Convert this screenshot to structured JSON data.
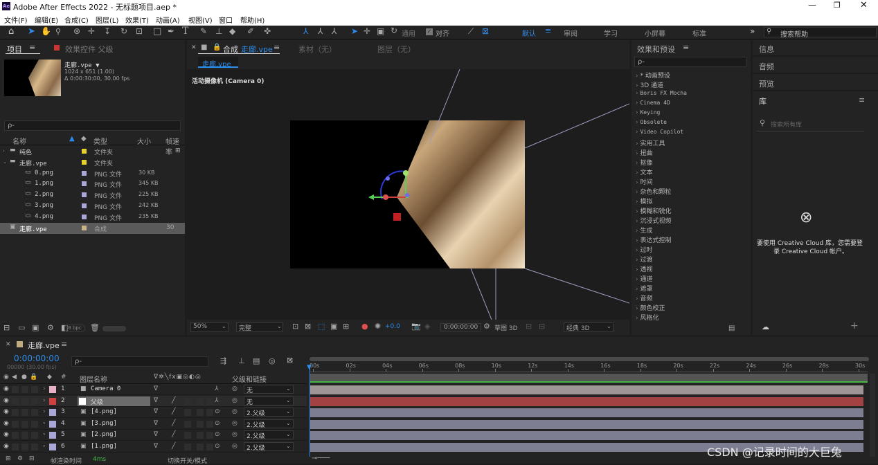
{
  "app": {
    "title": "Adobe After Effects 2022 - 无标题项目.aep *",
    "logo": "Ae"
  },
  "menu": [
    "文件(F)",
    "编辑(E)",
    "合成(C)",
    "图层(L)",
    "效果(T)",
    "动画(A)",
    "视图(V)",
    "窗口",
    "帮助(H)"
  ],
  "toolbar": {
    "snap_label": "对齐",
    "workspaces": [
      "默认",
      "审阅",
      "学习",
      "小屏幕",
      "标准"
    ],
    "search_placeholder": "搜索帮助"
  },
  "project": {
    "tab": "项目",
    "tab2": "效果控件 父级",
    "item_name": "走廊.vpe ▼",
    "item_info1": "1024 x 651 (1.00)",
    "item_info2": "Δ 0:00:30:00, 30.00 fps",
    "search_placeholder": "ρ-",
    "columns": [
      "名称",
      "类型",
      "大小",
      "帧速率"
    ],
    "rows": [
      {
        "name": "纯色",
        "type": "文件夹",
        "size": "",
        "fps": "",
        "indent": 0,
        "kind": "folder",
        "swatch": "#e6d32a"
      },
      {
        "name": "走廊.vpe",
        "type": "文件夹",
        "size": "",
        "fps": "",
        "indent": 0,
        "kind": "folder",
        "swatch": "#e6d32a"
      },
      {
        "name": "0.png",
        "type": "PNG 文件",
        "size": "30 KB",
        "fps": "",
        "indent": 1,
        "kind": "file",
        "swatch": "#a9a7d8"
      },
      {
        "name": "1.png",
        "type": "PNG 文件",
        "size": "345 KB",
        "fps": "",
        "indent": 1,
        "kind": "file",
        "swatch": "#a9a7d8"
      },
      {
        "name": "2.png",
        "type": "PNG 文件",
        "size": "225 KB",
        "fps": "",
        "indent": 1,
        "kind": "file",
        "swatch": "#a9a7d8"
      },
      {
        "name": "3.png",
        "type": "PNG 文件",
        "size": "242 KB",
        "fps": "",
        "indent": 1,
        "kind": "file",
        "swatch": "#a9a7d8"
      },
      {
        "name": "4.png",
        "type": "PNG 文件",
        "size": "235 KB",
        "fps": "",
        "indent": 1,
        "kind": "file",
        "swatch": "#a9a7d8"
      },
      {
        "name": "走廊.vpe",
        "type": "合成",
        "size": "",
        "fps": "30",
        "indent": 0,
        "kind": "comp",
        "swatch": "#c9b48a"
      }
    ],
    "bpc": "8 bpc"
  },
  "comp": {
    "tab_prefix": "合成",
    "tab_name": "走廊.vpe",
    "tab_footage": "素材（无）",
    "tab_layer": "图层（无）",
    "subtab": "走廊.vpe",
    "camera_label": "活动摄像机 (Camera 0)",
    "zoom": "50%",
    "quality": "完整",
    "exposure": "+0.0",
    "timecode": "0:00:00:00",
    "draft": "草图 3D",
    "renderer": "经典 3D"
  },
  "effects": {
    "title": "效果和预设",
    "search_placeholder": "ρ-",
    "items": [
      "* 动画预设",
      "3D 通道",
      "Boris FX Mocha",
      "Cinema 4D",
      "Keying",
      "Obsolete",
      "Video Copilot",
      "实用工具",
      "扭曲",
      "抠像",
      "文本",
      "时间",
      "杂色和颗粒",
      "模拟",
      "模糊和锐化",
      "沉浸式视频",
      "生成",
      "表达式控制",
      "过时",
      "过渡",
      "透视",
      "通道",
      "遮罩",
      "音频",
      "颜色校正",
      "风格化"
    ]
  },
  "right": {
    "info": "信息",
    "audio": "音频",
    "preview": "预览",
    "library": "库",
    "lib_search": "搜索所有库",
    "cc_msg1": "要使用 Creative Cloud 库，您需要登",
    "cc_msg2": "录 Creative Cloud 帐户。"
  },
  "timeline": {
    "tab": "走廊.vpe",
    "timecode": "0:00:00:00",
    "fps": "00000 (30.00 fps)",
    "search_placeholder": "ρ-",
    "col_name": "图层名称",
    "col_parent": "父级和链接",
    "ruler": [
      "00s",
      "02s",
      "04s",
      "06s",
      "08s",
      "10s",
      "12s",
      "14s",
      "16s",
      "18s",
      "20s",
      "22s",
      "24s",
      "26s",
      "28s",
      "30s"
    ],
    "layers": [
      {
        "num": "1",
        "name": "Camera 0",
        "label": "#e7b0c6",
        "parent": "无",
        "bar": "#a09596",
        "kind": "camera"
      },
      {
        "num": "2",
        "name": "父级",
        "label": "#d0403f",
        "parent": "无",
        "bar": "#a24242",
        "kind": "solid"
      },
      {
        "num": "3",
        "name": "[4.png]",
        "label": "#a9a7d8",
        "parent": "2.父级",
        "bar": "#7e7e93",
        "kind": "file"
      },
      {
        "num": "4",
        "name": "[3.png]",
        "label": "#a9a7d8",
        "parent": "2.父级",
        "bar": "#7e7e93",
        "kind": "file"
      },
      {
        "num": "5",
        "name": "[2.png]",
        "label": "#a9a7d8",
        "parent": "2.父级",
        "bar": "#7e7e93",
        "kind": "file"
      },
      {
        "num": "6",
        "name": "[1.png]",
        "label": "#a9a7d8",
        "parent": "2.父级",
        "bar": "#7e7e93",
        "kind": "file"
      }
    ],
    "footer_render": "帧渲染时间",
    "footer_ms": "4ms",
    "footer_switch": "切换开关/模式"
  },
  "watermark": "CSDN @记录时间的大巨兔"
}
